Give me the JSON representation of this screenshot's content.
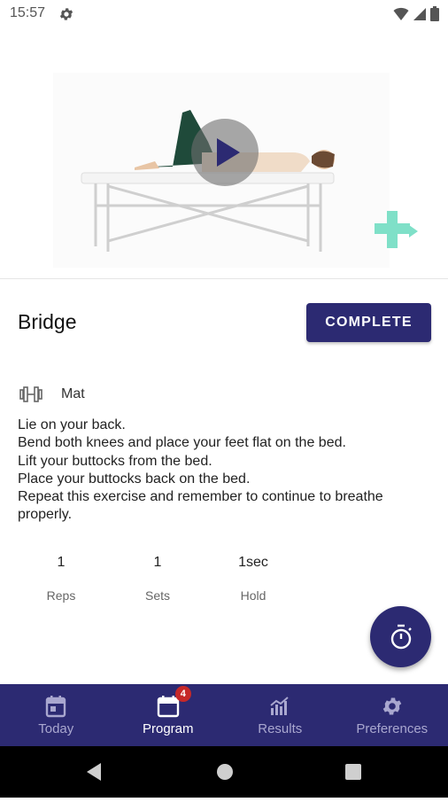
{
  "status_bar": {
    "time": "15:57",
    "icons": [
      "gear-icon",
      "wifi-icon",
      "signal-icon",
      "battery-icon"
    ]
  },
  "video": {
    "play_icon": "play-icon",
    "logo": "physio-cross-logo"
  },
  "exercise": {
    "title": "Bridge",
    "complete_label": "COMPLETE",
    "equipment_icon": "dumbbell-icon",
    "equipment": "Mat",
    "instructions": [
      "Lie on your back.",
      "Bend both knees and place your feet flat on the bed.",
      "Lift your buttocks from the bed.",
      "Place your buttocks back on the bed.",
      "Repeat this exercise and remember to continue to breathe",
      "properly."
    ],
    "stats": [
      {
        "value": "1",
        "label": "Reps"
      },
      {
        "value": "1",
        "label": "Sets"
      },
      {
        "value": "1sec",
        "label": "Hold"
      }
    ]
  },
  "fab": {
    "icon": "stopwatch-icon"
  },
  "nav": {
    "items": [
      {
        "label": "Today",
        "icon": "calendar-today-icon",
        "active": false
      },
      {
        "label": "Program",
        "icon": "calendar-icon",
        "active": true,
        "badge": "4"
      },
      {
        "label": "Results",
        "icon": "bar-chart-icon",
        "active": false
      },
      {
        "label": "Preferences",
        "icon": "gear-icon",
        "active": false
      }
    ]
  },
  "colors": {
    "primary": "#2c2a72",
    "badge": "#c62828",
    "inactive_nav": "#a9a7cf",
    "logo": "#7fe0c8"
  }
}
